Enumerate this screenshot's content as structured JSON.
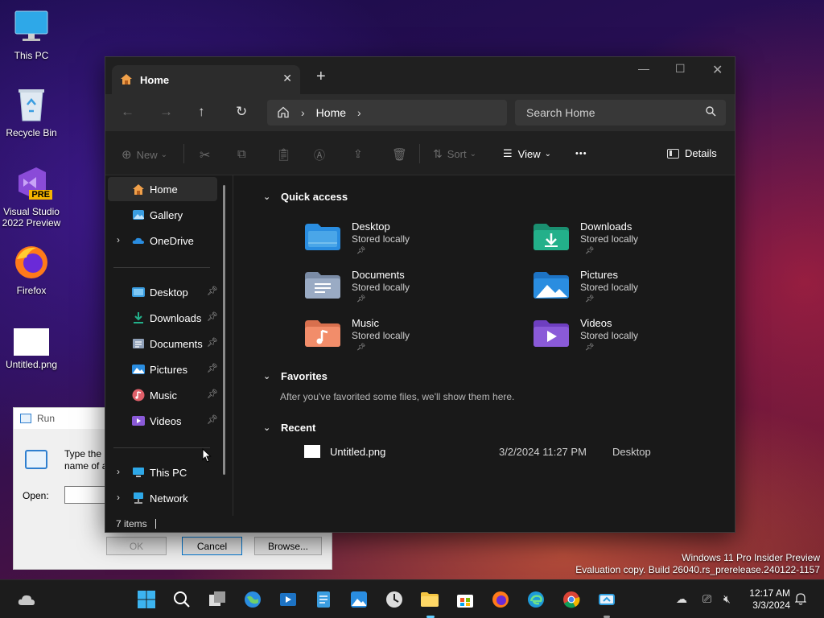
{
  "desktop": {
    "icons": [
      {
        "label": "This PC"
      },
      {
        "label": "Recycle Bin"
      },
      {
        "label": "Visual Studio 2022 Preview",
        "badge": "PRE"
      },
      {
        "label": "Firefox"
      },
      {
        "label": "Untitled.png"
      }
    ],
    "watermark": {
      "line1": "Windows 11 Pro Insider Preview",
      "line2": "Evaluation copy. Build 26040.rs_prerelease.240122-1157"
    }
  },
  "run_dialog": {
    "title": "Run",
    "description": "Type the name of a program, folder, document, or Internet resource, and Windows will open it for you.",
    "open_label": "Open:",
    "open_value": "",
    "ok_label": "OK",
    "cancel_label": "Cancel",
    "browse_label": "Browse..."
  },
  "explorer": {
    "tab_title": "Home",
    "new_tab_glyph": "+",
    "breadcrumb": [
      "Home"
    ],
    "search_placeholder": "Search Home",
    "toolbar": {
      "new_label": "New",
      "sort_label": "Sort",
      "view_label": "View",
      "more_glyph": "•••",
      "details_label": "Details"
    },
    "sidebar": {
      "top": [
        {
          "label": "Home",
          "selected": true
        },
        {
          "label": "Gallery"
        },
        {
          "label": "OneDrive",
          "expandable": true
        }
      ],
      "pinned": [
        {
          "label": "Desktop"
        },
        {
          "label": "Downloads"
        },
        {
          "label": "Documents"
        },
        {
          "label": "Pictures"
        },
        {
          "label": "Music"
        },
        {
          "label": "Videos"
        }
      ],
      "bottom": [
        {
          "label": "This PC",
          "expandable": true
        },
        {
          "label": "Network",
          "expandable": true
        }
      ]
    },
    "quick_access": {
      "heading": "Quick access",
      "items": [
        {
          "name": "Desktop",
          "status": "Stored locally"
        },
        {
          "name": "Downloads",
          "status": "Stored locally"
        },
        {
          "name": "Documents",
          "status": "Stored locally"
        },
        {
          "name": "Pictures",
          "status": "Stored locally"
        },
        {
          "name": "Music",
          "status": "Stored locally"
        },
        {
          "name": "Videos",
          "status": "Stored locally"
        }
      ]
    },
    "favorites": {
      "heading": "Favorites",
      "empty_message": "After you've favorited some files, we'll show them here."
    },
    "recent": {
      "heading": "Recent",
      "items": [
        {
          "name": "Untitled.png",
          "date": "3/2/2024 11:27 PM",
          "location": "Desktop"
        }
      ]
    },
    "status_bar": "7 items"
  },
  "taskbar": {
    "clock_time": "12:17 AM",
    "clock_date": "3/3/2024"
  },
  "colors": {
    "accent": "#60cdff",
    "folder_blue": "#4aa6e8",
    "folder_green": "#23b08a",
    "folder_orange": "#f28d6a",
    "folder_purple": "#8a5ad8"
  }
}
